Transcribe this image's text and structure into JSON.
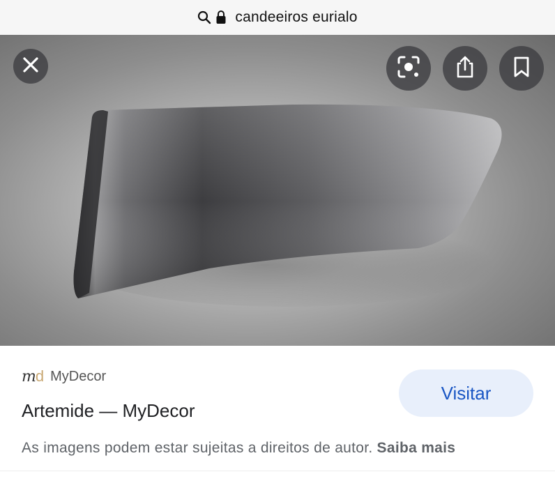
{
  "address_bar": {
    "url_text": "candeeiros eurialo",
    "icons": [
      "search-icon",
      "lock-icon"
    ]
  },
  "image_viewer": {
    "buttons": {
      "close": "close-icon",
      "lens": "lens-scan-icon",
      "share": "share-icon",
      "bookmark": "bookmark-icon"
    }
  },
  "result": {
    "source_logo_text": "m",
    "source_logo_accent": "d",
    "source_name": "MyDecor",
    "title": "Artemide — MyDecor",
    "visit_label": "Visitar",
    "copyright_text": "As imagens podem estar sujeitas a direitos de autor.",
    "learn_more_label": "Saiba mais"
  },
  "colors": {
    "visit_bg": "#e8effb",
    "visit_text": "#1a56c4",
    "logo_accent": "#c9a873"
  }
}
